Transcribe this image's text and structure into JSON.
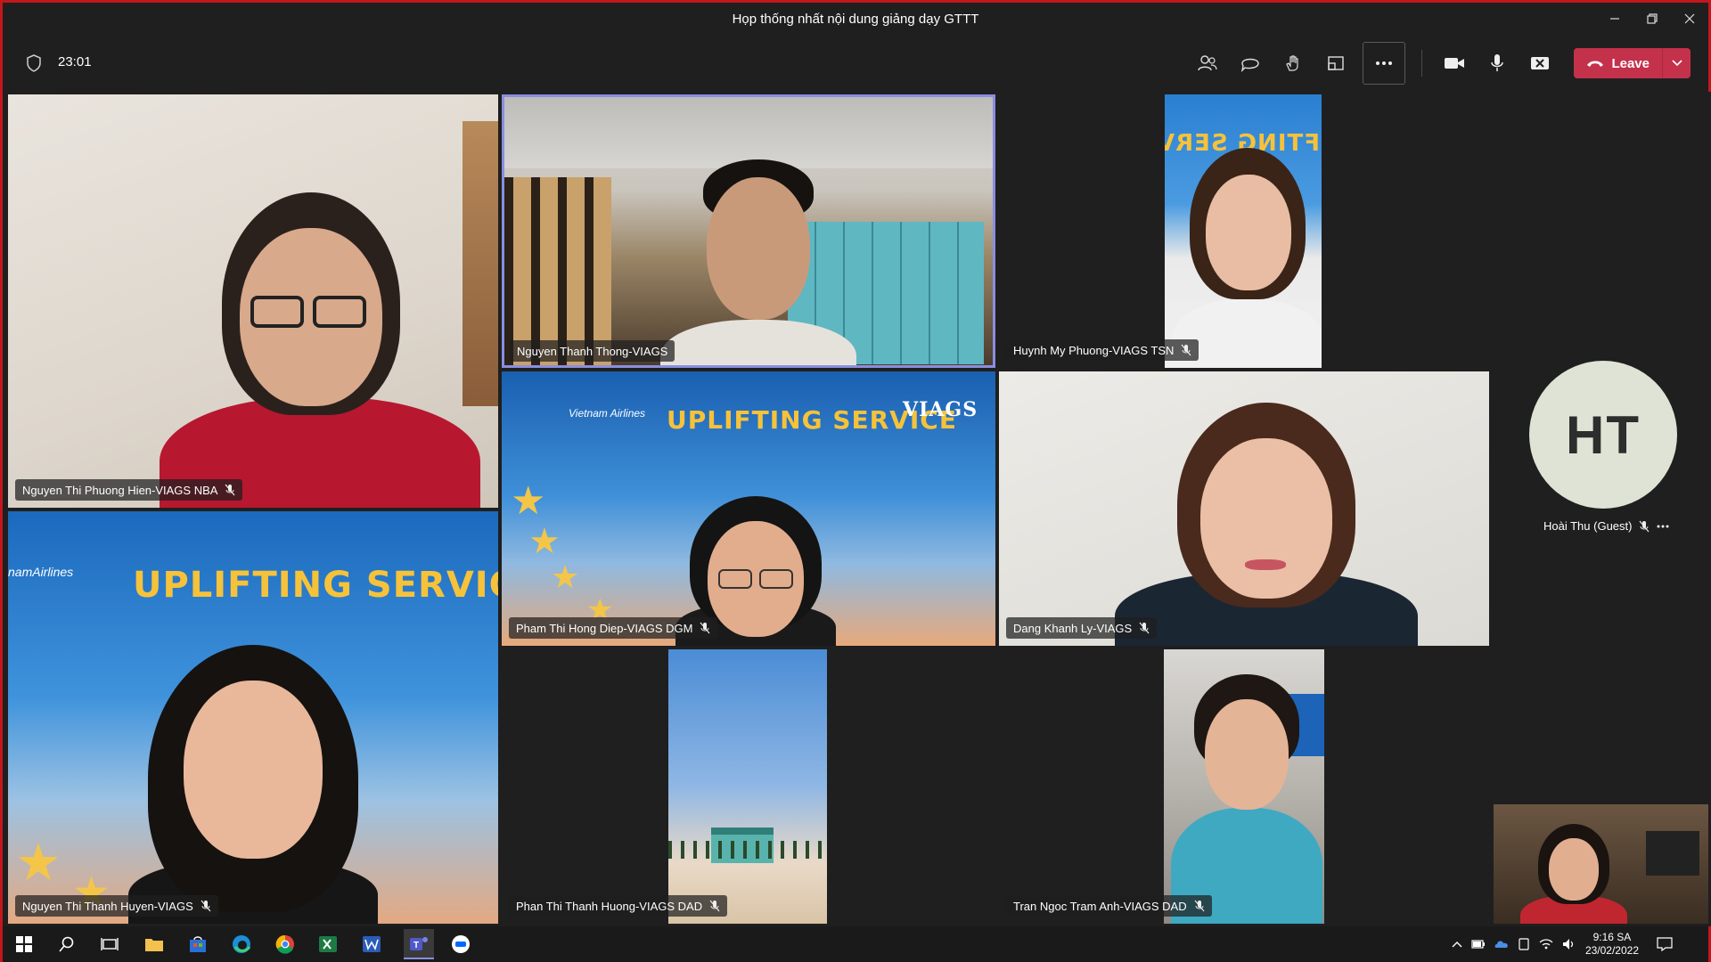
{
  "window": {
    "title": "Họp thống nhất nội dung giảng dạy GTTT"
  },
  "toolbar": {
    "timer": "23:01",
    "leave_label": "Leave"
  },
  "participants": [
    {
      "name": "Nguyen Thi Phuong Hien-VIAGS NBA"
    },
    {
      "name": "Nguyen Thanh Thong-VIAGS"
    },
    {
      "name": "Huynh My Phuong-VIAGS TSN"
    },
    {
      "name": "Pham Thi Hong Diep-VIAGS DGM"
    },
    {
      "name": "Dang Khanh Ly-VIAGS"
    },
    {
      "name": "Nguyen Thi Thanh Huyen-VIAGS"
    },
    {
      "name": "Phan Thi Thanh Huong-VIAGS DAD"
    },
    {
      "name": "Tran Ngoc Tram Anh-VIAGS DAD"
    }
  ],
  "banner": {
    "headline": "UPLIFTING SERVICE",
    "mirrored": "UPLIFTING SERV",
    "brand": "VIAGS",
    "airline": "Vietnam Airlines",
    "airline_cropped": "namAirlines"
  },
  "guest": {
    "initials": "HT",
    "name": "Hoài Thu (Guest)"
  },
  "taskbar": {
    "time": "9:16 SA",
    "date": "23/02/2022"
  },
  "colors": {
    "leave": "#c4314b",
    "frame": "#c4161c",
    "accent": "#6264a7"
  }
}
